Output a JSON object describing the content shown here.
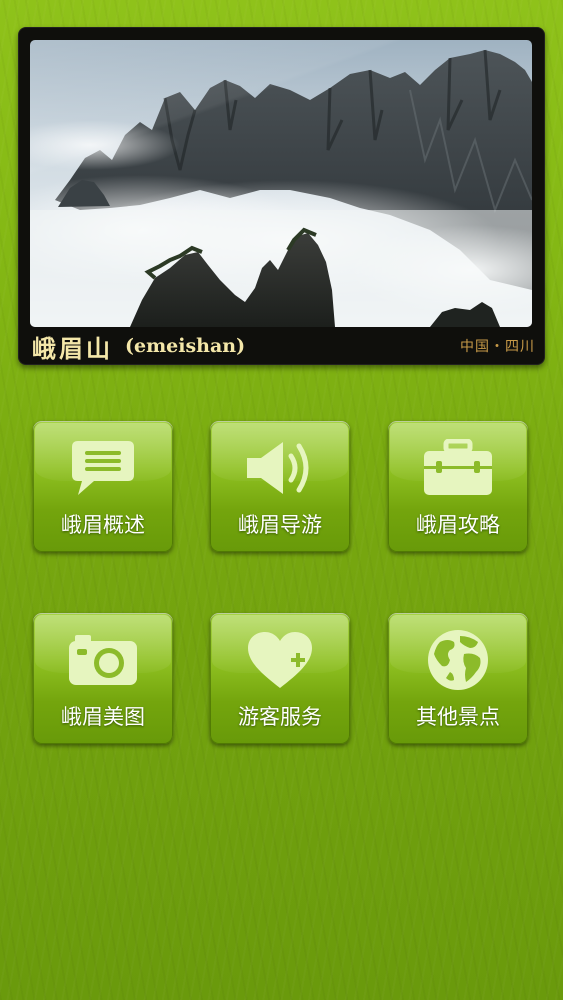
{
  "banner": {
    "title_cn": "峨眉山",
    "title_en": "(emeishan)",
    "location": "中国・四川"
  },
  "menu": [
    {
      "label": "峨眉概述",
      "icon": "speech-bubble-icon"
    },
    {
      "label": "峨眉导游",
      "icon": "speaker-icon"
    },
    {
      "label": "峨眉攻略",
      "icon": "briefcase-icon"
    },
    {
      "label": "峨眉美图",
      "icon": "camera-icon"
    },
    {
      "label": "游客服务",
      "icon": "heart-plus-icon"
    },
    {
      "label": "其他景点",
      "icon": "globe-icon"
    }
  ],
  "colors": {
    "background": "#84b814",
    "button": "#8ec021",
    "icon": "#e6f5bf",
    "caption_text": "#f4e7a9",
    "location_text": "#c79a48"
  }
}
